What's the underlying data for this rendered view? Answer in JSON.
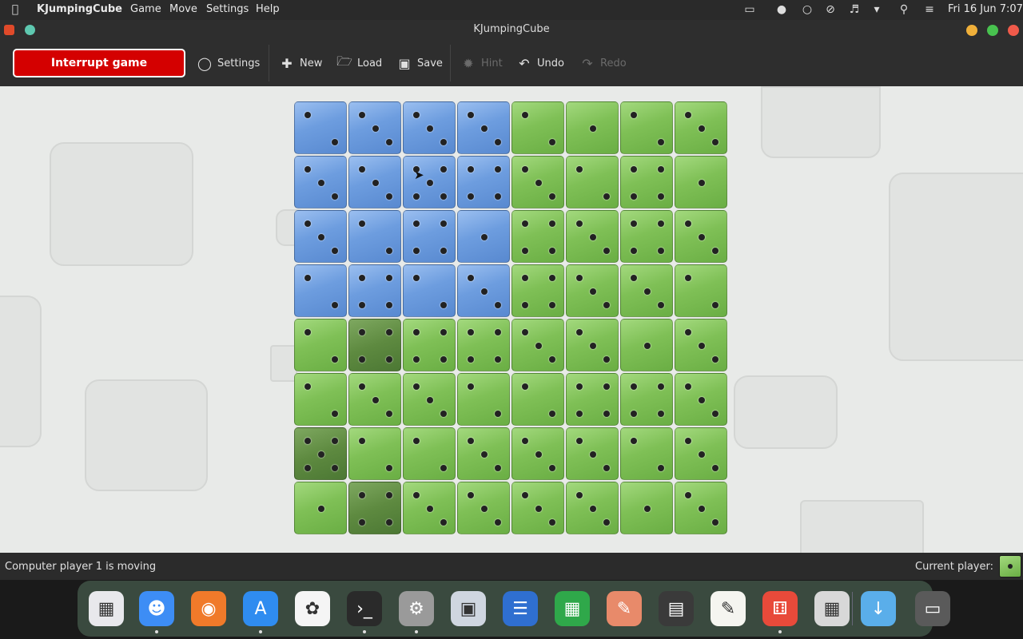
{
  "menubar": {
    "app_name": "KJumpingCube",
    "menus": [
      "Game",
      "Move",
      "Settings",
      "Help"
    ],
    "clock": "Fri 16 Jun  7:07"
  },
  "window": {
    "title": "KJumpingCube"
  },
  "toolbar": {
    "interrupt": "Interrupt game",
    "settings": "Settings",
    "new": "New",
    "load": "Load",
    "save": "Save",
    "hint": "Hint",
    "undo": "Undo",
    "redo": "Redo"
  },
  "status": {
    "message": "Computer player 1 is moving",
    "current_player_label": "Current player:"
  },
  "colors": {
    "player1": "#6d9ddf",
    "player2": "#7fc056",
    "highlight": "#5e8a40",
    "interrupt": "#d40000"
  },
  "board": {
    "size": 8,
    "rows": [
      [
        {
          "c": "b",
          "p": 2
        },
        {
          "c": "b",
          "p": 3
        },
        {
          "c": "b",
          "p": 3
        },
        {
          "c": "b",
          "p": 3
        },
        {
          "c": "g",
          "p": 2
        },
        {
          "c": "g",
          "p": 1
        },
        {
          "c": "g",
          "p": 2
        },
        {
          "c": "g",
          "p": 3
        }
      ],
      [
        {
          "c": "b",
          "p": 3
        },
        {
          "c": "b",
          "p": 3
        },
        {
          "c": "b",
          "p": 5
        },
        {
          "c": "b",
          "p": 4
        },
        {
          "c": "g",
          "p": 3
        },
        {
          "c": "g",
          "p": 2
        },
        {
          "c": "g",
          "p": 4
        },
        {
          "c": "g",
          "p": 1
        }
      ],
      [
        {
          "c": "b",
          "p": 3
        },
        {
          "c": "b",
          "p": 2
        },
        {
          "c": "b",
          "p": 4
        },
        {
          "c": "b",
          "p": 1
        },
        {
          "c": "g",
          "p": 4
        },
        {
          "c": "g",
          "p": 3
        },
        {
          "c": "g",
          "p": 4
        },
        {
          "c": "g",
          "p": 3
        }
      ],
      [
        {
          "c": "b",
          "p": 2
        },
        {
          "c": "b",
          "p": 4
        },
        {
          "c": "b",
          "p": 2
        },
        {
          "c": "b",
          "p": 3
        },
        {
          "c": "g",
          "p": 4
        },
        {
          "c": "g",
          "p": 3
        },
        {
          "c": "g",
          "p": 3
        },
        {
          "c": "g",
          "p": 2
        }
      ],
      [
        {
          "c": "g",
          "p": 2
        },
        {
          "c": "d",
          "p": 4
        },
        {
          "c": "g",
          "p": 4
        },
        {
          "c": "g",
          "p": 4
        },
        {
          "c": "g",
          "p": 3
        },
        {
          "c": "g",
          "p": 3
        },
        {
          "c": "g",
          "p": 1
        },
        {
          "c": "g",
          "p": 3
        }
      ],
      [
        {
          "c": "g",
          "p": 2
        },
        {
          "c": "g",
          "p": 3
        },
        {
          "c": "g",
          "p": 3
        },
        {
          "c": "g",
          "p": 2
        },
        {
          "c": "g",
          "p": 2
        },
        {
          "c": "g",
          "p": 4
        },
        {
          "c": "g",
          "p": 4
        },
        {
          "c": "g",
          "p": 3
        }
      ],
      [
        {
          "c": "d",
          "p": 5
        },
        {
          "c": "g",
          "p": 2
        },
        {
          "c": "g",
          "p": 2
        },
        {
          "c": "g",
          "p": 3
        },
        {
          "c": "g",
          "p": 3
        },
        {
          "c": "g",
          "p": 3
        },
        {
          "c": "g",
          "p": 2
        },
        {
          "c": "g",
          "p": 3
        }
      ],
      [
        {
          "c": "g",
          "p": 1
        },
        {
          "c": "d",
          "p": 4
        },
        {
          "c": "g",
          "p": 3
        },
        {
          "c": "g",
          "p": 3
        },
        {
          "c": "g",
          "p": 3
        },
        {
          "c": "g",
          "p": 3
        },
        {
          "c": "g",
          "p": 1
        },
        {
          "c": "g",
          "p": 3
        }
      ]
    ]
  },
  "dock": {
    "apps": [
      "launchpad-icon",
      "finder-icon",
      "firefox-icon",
      "app-store-icon",
      "photos-icon",
      "terminal-icon",
      "system-settings-icon",
      "screenshot-icon",
      "text-editor-icon",
      "spreadsheet-icon",
      "drawing-icon",
      "media-player-icon",
      "notes-icon",
      "dice-game-icon",
      "calculator-icon",
      "downloads-folder-icon",
      "trash-icon"
    ]
  }
}
